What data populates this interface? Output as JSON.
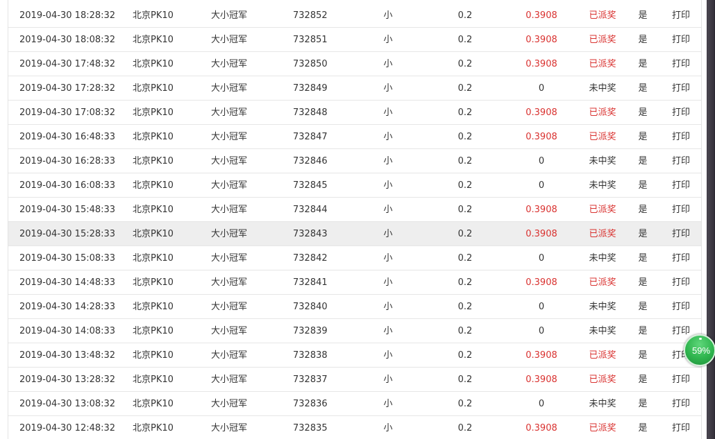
{
  "rows": [
    {
      "time": "2019-04-30 18:28:32",
      "lottery": "北京PK10",
      "play": "大小冠军",
      "issue": "732852",
      "pick": "小",
      "amount": "0.2",
      "bonus": "0.3908",
      "status": "已派奖",
      "flag": "是",
      "action": "打印"
    },
    {
      "time": "2019-04-30 18:08:32",
      "lottery": "北京PK10",
      "play": "大小冠军",
      "issue": "732851",
      "pick": "小",
      "amount": "0.2",
      "bonus": "0.3908",
      "status": "已派奖",
      "flag": "是",
      "action": "打印"
    },
    {
      "time": "2019-04-30 17:48:32",
      "lottery": "北京PK10",
      "play": "大小冠军",
      "issue": "732850",
      "pick": "小",
      "amount": "0.2",
      "bonus": "0.3908",
      "status": "已派奖",
      "flag": "是",
      "action": "打印"
    },
    {
      "time": "2019-04-30 17:28:32",
      "lottery": "北京PK10",
      "play": "大小冠军",
      "issue": "732849",
      "pick": "小",
      "amount": "0.2",
      "bonus": "0",
      "status": "未中奖",
      "flag": "是",
      "action": "打印"
    },
    {
      "time": "2019-04-30 17:08:32",
      "lottery": "北京PK10",
      "play": "大小冠军",
      "issue": "732848",
      "pick": "小",
      "amount": "0.2",
      "bonus": "0.3908",
      "status": "已派奖",
      "flag": "是",
      "action": "打印"
    },
    {
      "time": "2019-04-30 16:48:33",
      "lottery": "北京PK10",
      "play": "大小冠军",
      "issue": "732847",
      "pick": "小",
      "amount": "0.2",
      "bonus": "0.3908",
      "status": "已派奖",
      "flag": "是",
      "action": "打印"
    },
    {
      "time": "2019-04-30 16:28:33",
      "lottery": "北京PK10",
      "play": "大小冠军",
      "issue": "732846",
      "pick": "小",
      "amount": "0.2",
      "bonus": "0",
      "status": "未中奖",
      "flag": "是",
      "action": "打印"
    },
    {
      "time": "2019-04-30 16:08:33",
      "lottery": "北京PK10",
      "play": "大小冠军",
      "issue": "732845",
      "pick": "小",
      "amount": "0.2",
      "bonus": "0",
      "status": "未中奖",
      "flag": "是",
      "action": "打印"
    },
    {
      "time": "2019-04-30 15:48:33",
      "lottery": "北京PK10",
      "play": "大小冠军",
      "issue": "732844",
      "pick": "小",
      "amount": "0.2",
      "bonus": "0.3908",
      "status": "已派奖",
      "flag": "是",
      "action": "打印"
    },
    {
      "time": "2019-04-30 15:28:33",
      "lottery": "北京PK10",
      "play": "大小冠军",
      "issue": "732843",
      "pick": "小",
      "amount": "0.2",
      "bonus": "0.3908",
      "status": "已派奖",
      "flag": "是",
      "action": "打印"
    },
    {
      "time": "2019-04-30 15:08:33",
      "lottery": "北京PK10",
      "play": "大小冠军",
      "issue": "732842",
      "pick": "小",
      "amount": "0.2",
      "bonus": "0",
      "status": "未中奖",
      "flag": "是",
      "action": "打印"
    },
    {
      "time": "2019-04-30 14:48:33",
      "lottery": "北京PK10",
      "play": "大小冠军",
      "issue": "732841",
      "pick": "小",
      "amount": "0.2",
      "bonus": "0.3908",
      "status": "已派奖",
      "flag": "是",
      "action": "打印"
    },
    {
      "time": "2019-04-30 14:28:33",
      "lottery": "北京PK10",
      "play": "大小冠军",
      "issue": "732840",
      "pick": "小",
      "amount": "0.2",
      "bonus": "0",
      "status": "未中奖",
      "flag": "是",
      "action": "打印"
    },
    {
      "time": "2019-04-30 14:08:33",
      "lottery": "北京PK10",
      "play": "大小冠军",
      "issue": "732839",
      "pick": "小",
      "amount": "0.2",
      "bonus": "0",
      "status": "未中奖",
      "flag": "是",
      "action": "打印"
    },
    {
      "time": "2019-04-30 13:48:32",
      "lottery": "北京PK10",
      "play": "大小冠军",
      "issue": "732838",
      "pick": "小",
      "amount": "0.2",
      "bonus": "0.3908",
      "status": "已派奖",
      "flag": "是",
      "action": "打印"
    },
    {
      "time": "2019-04-30 13:28:32",
      "lottery": "北京PK10",
      "play": "大小冠军",
      "issue": "732837",
      "pick": "小",
      "amount": "0.2",
      "bonus": "0.3908",
      "status": "已派奖",
      "flag": "是",
      "action": "打印"
    },
    {
      "time": "2019-04-30 13:08:32",
      "lottery": "北京PK10",
      "play": "大小冠军",
      "issue": "732836",
      "pick": "小",
      "amount": "0.2",
      "bonus": "0",
      "status": "未中奖",
      "flag": "是",
      "action": "打印"
    },
    {
      "time": "2019-04-30 12:48:32",
      "lottery": "北京PK10",
      "play": "大小冠军",
      "issue": "732835",
      "pick": "小",
      "amount": "0.2",
      "bonus": "0.3908",
      "status": "已派奖",
      "flag": "是",
      "action": "打印"
    }
  ],
  "highlighted_row": 9,
  "speed_widget": {
    "percent_label": "59%",
    "percent": 59
  },
  "colors": {
    "win": "#d9312f",
    "text": "#333333",
    "row_highlight": "#eeeeee",
    "border": "#e6e6e6",
    "widget_green": "#2fb54e",
    "scrollbar": "#3f3b45"
  }
}
